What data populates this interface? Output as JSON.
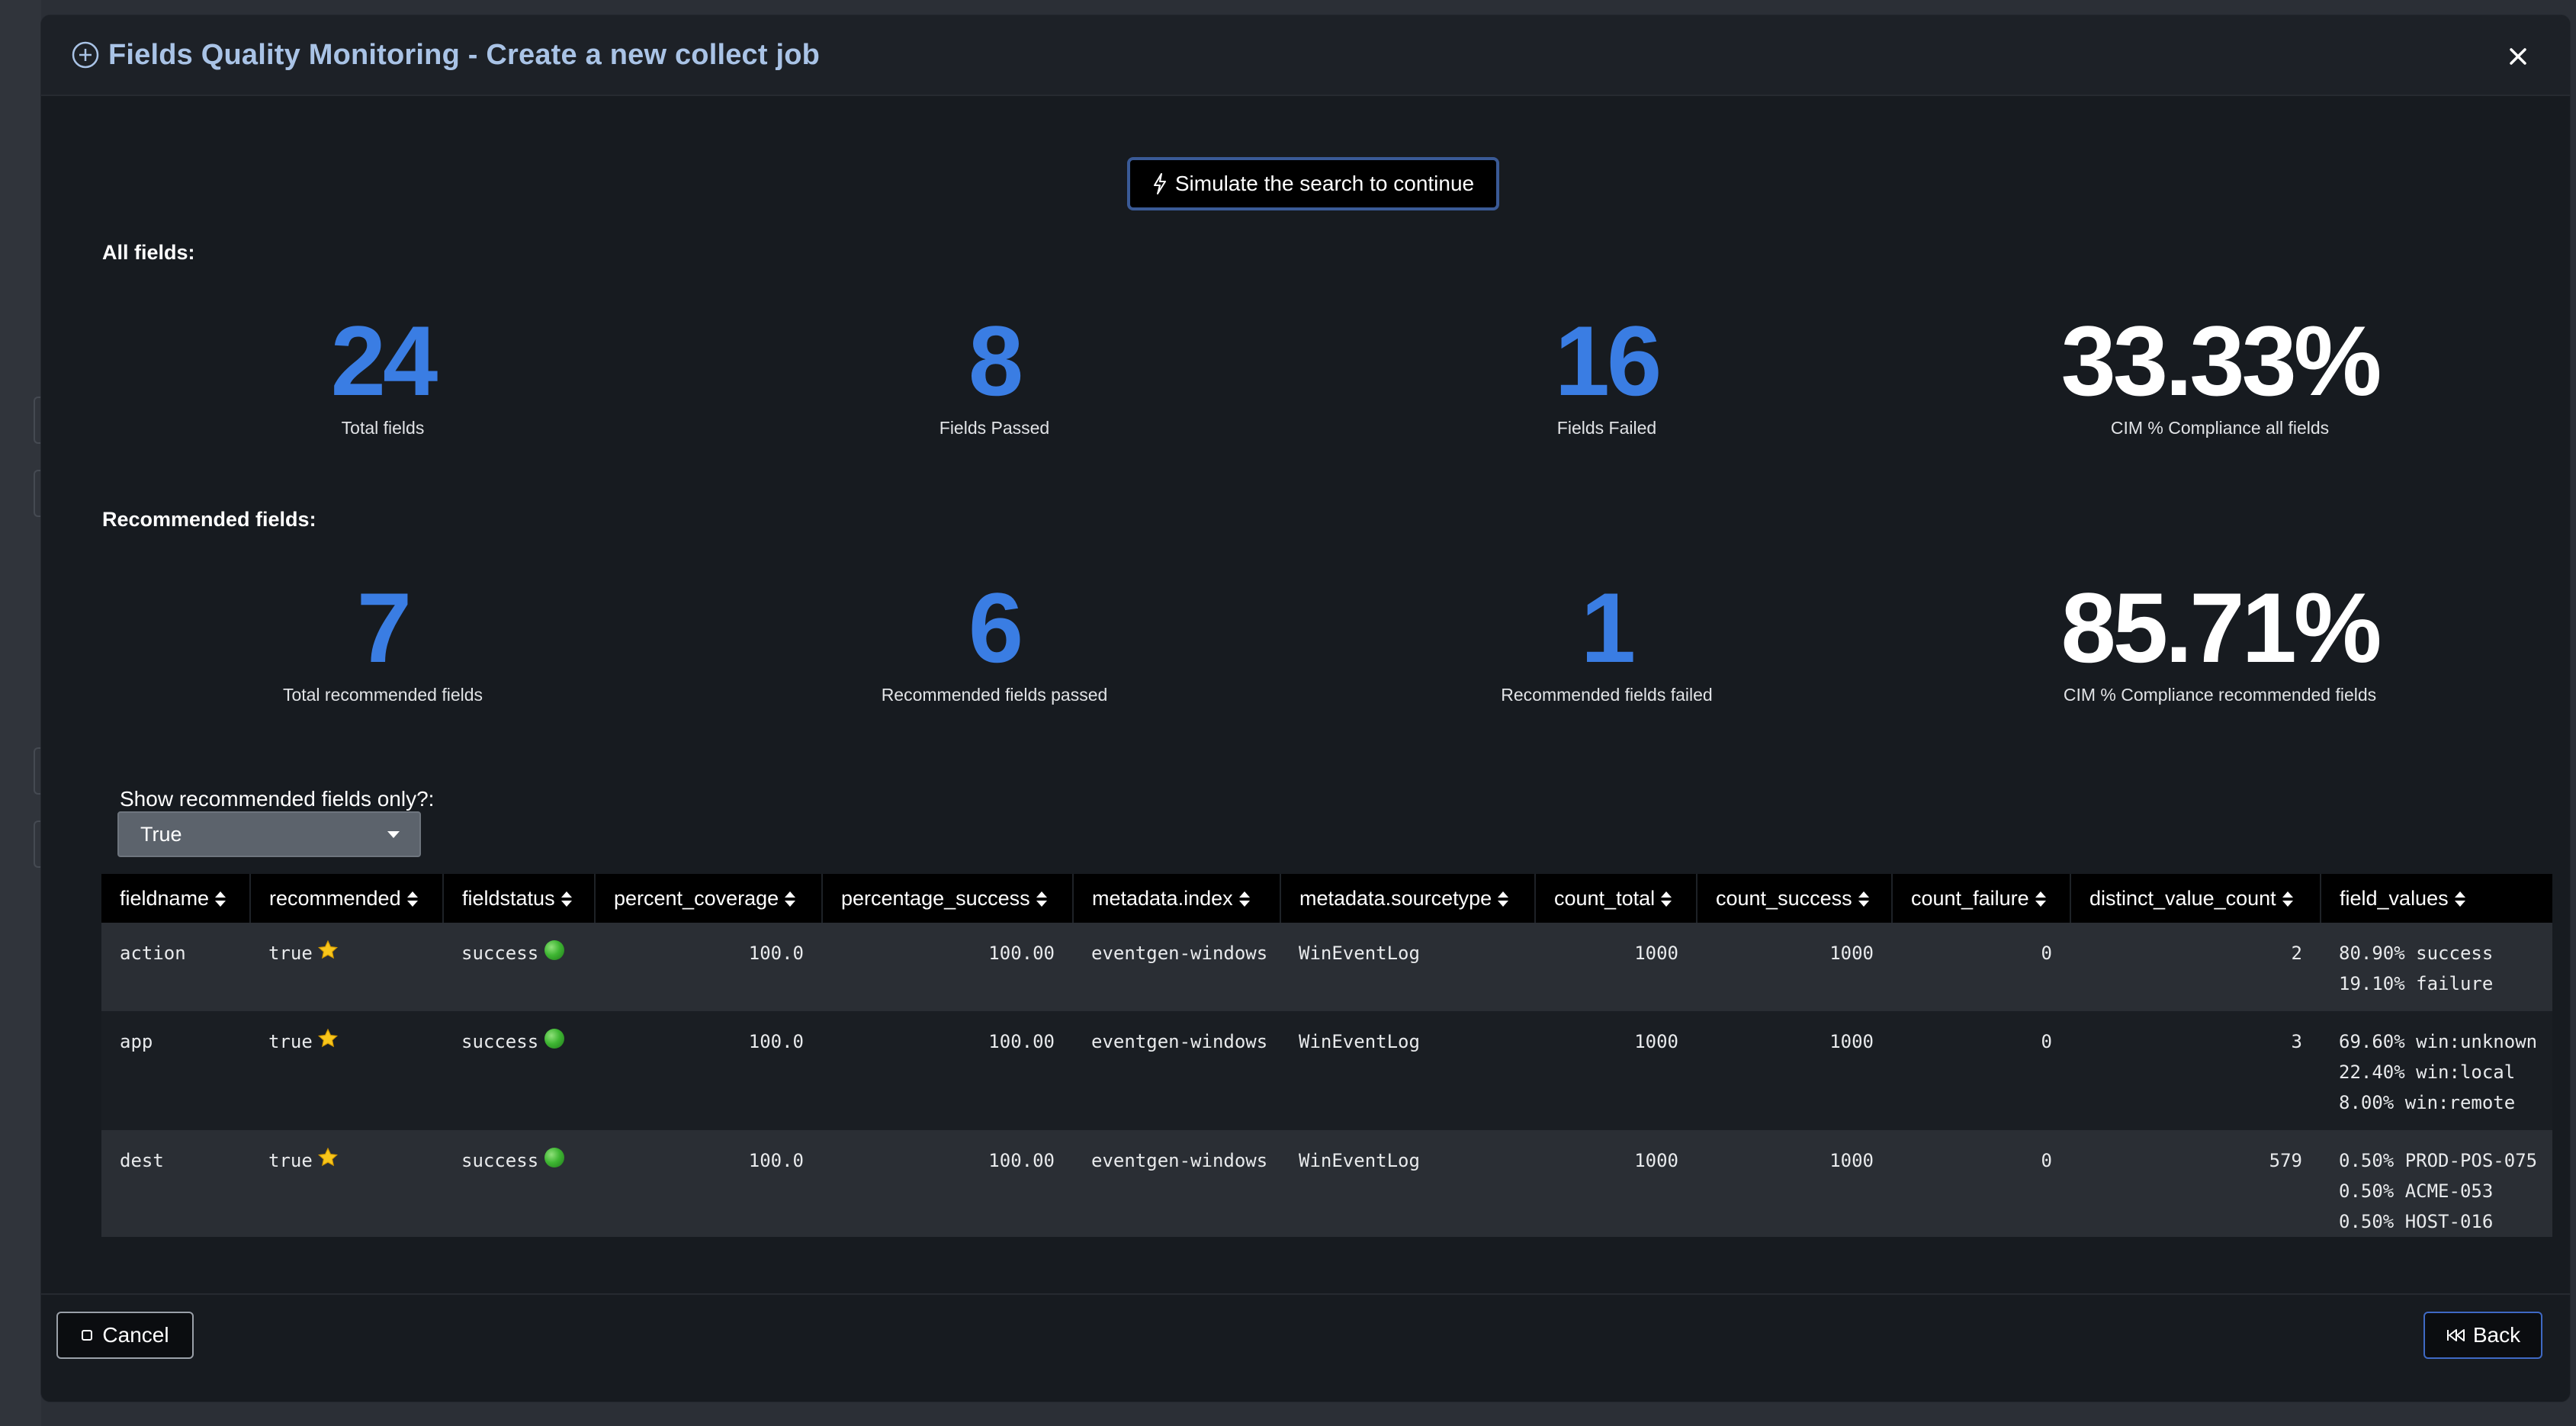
{
  "modal": {
    "title": "Fields Quality Monitoring - Create a new collect job",
    "header_icon": "plus-circle-icon",
    "close_icon": "close-icon"
  },
  "simulate_button": {
    "label": "Simulate the search to continue",
    "icon": "lightning-bolt-icon"
  },
  "all_fields": {
    "section_label": "All fields:",
    "stats": [
      {
        "value": "24",
        "label": "Total fields"
      },
      {
        "value": "8",
        "label": "Fields Passed"
      },
      {
        "value": "16",
        "label": "Fields Failed"
      },
      {
        "value": "33.33%",
        "label": "CIM % Compliance all fields"
      }
    ]
  },
  "recommended_fields": {
    "section_label": "Recommended fields:",
    "stats": [
      {
        "value": "7",
        "label": "Total recommended fields"
      },
      {
        "value": "6",
        "label": "Recommended fields passed"
      },
      {
        "value": "1",
        "label": "Recommended fields failed"
      },
      {
        "value": "85.71%",
        "label": "CIM % Compliance recommended fields"
      }
    ]
  },
  "filter": {
    "label": "Show recommended fields only?:",
    "selected": "True"
  },
  "table": {
    "columns": [
      "fieldname",
      "recommended",
      "fieldstatus",
      "percent_coverage",
      "percentage_success",
      "metadata.index",
      "metadata.sourcetype",
      "count_total",
      "count_success",
      "count_failure",
      "distinct_value_count",
      "field_values"
    ],
    "rows": [
      {
        "fieldname": "action",
        "recommended": "true",
        "fieldstatus": "success",
        "percent_coverage": "100.0",
        "percentage_success": "100.00",
        "metadata_index": "eventgen-windows",
        "metadata_sourcetype": "WinEventLog",
        "count_total": "1000",
        "count_success": "1000",
        "count_failure": "0",
        "distinct_value_count": "2",
        "field_values": [
          "80.90% success",
          "19.10% failure"
        ]
      },
      {
        "fieldname": "app",
        "recommended": "true",
        "fieldstatus": "success",
        "percent_coverage": "100.0",
        "percentage_success": "100.00",
        "metadata_index": "eventgen-windows",
        "metadata_sourcetype": "WinEventLog",
        "count_total": "1000",
        "count_success": "1000",
        "count_failure": "0",
        "distinct_value_count": "3",
        "field_values": [
          "69.60% win:unknown",
          "22.40% win:local",
          "8.00% win:remote"
        ]
      },
      {
        "fieldname": "dest",
        "recommended": "true",
        "fieldstatus": "success",
        "percent_coverage": "100.0",
        "percentage_success": "100.00",
        "metadata_index": "eventgen-windows",
        "metadata_sourcetype": "WinEventLog",
        "count_total": "1000",
        "count_success": "1000",
        "count_failure": "0",
        "distinct_value_count": "579",
        "field_values": [
          "0.50% PROD-POS-075",
          "0.50% ACME-053",
          "0.50% HOST-016"
        ]
      }
    ]
  },
  "footer": {
    "cancel_label": "Cancel",
    "back_label": "Back"
  },
  "colors": {
    "accent_blue": "#3a7de3",
    "title_blue": "#a9c3e6",
    "modal_bg": "#171b20"
  }
}
